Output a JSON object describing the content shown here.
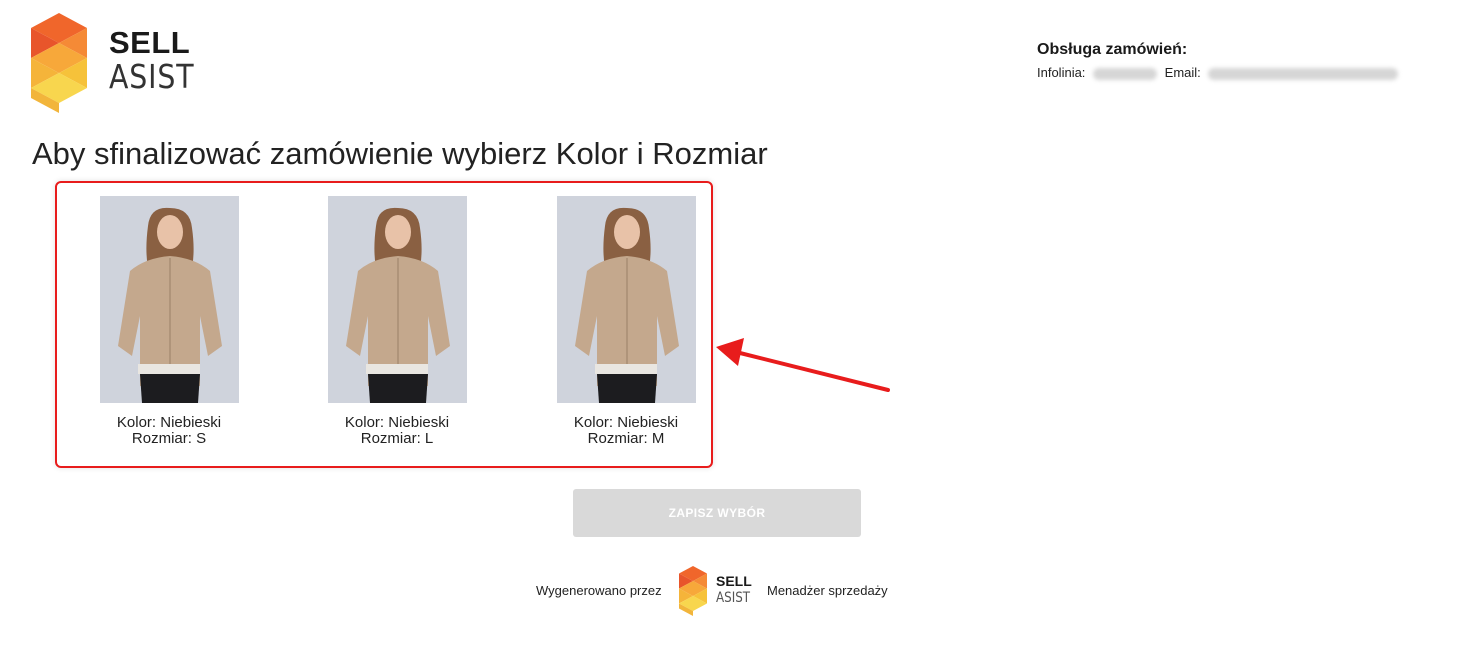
{
  "brand": {
    "line1": "SELL",
    "line2": "ASIST",
    "colors": {
      "orange": "#f26b2a",
      "dark_orange": "#e8552b",
      "yellow": "#f6c23a",
      "light_yellow": "#f8d64e"
    }
  },
  "contact": {
    "title": "Obsługa zamówień:",
    "phone_label": "Infolinia:",
    "email_label": "Email:"
  },
  "heading": "Aby sfinalizować zamówienie wybierz Kolor i Rozmiar",
  "variants": [
    {
      "color_line": "Kolor: Niebieski",
      "size_line": "Rozmiar: S"
    },
    {
      "color_line": "Kolor: Niebieski",
      "size_line": "Rozmiar: L"
    },
    {
      "color_line": "Kolor: Niebieski",
      "size_line": "Rozmiar: M"
    }
  ],
  "highlight_color": "#e81c1c",
  "save_button": {
    "label": "ZAPISZ WYBÓR",
    "color": "#d9d9d9"
  },
  "footer": {
    "prefix": "Wygenerowano przez",
    "logo_line1": "SELL",
    "logo_line2": "ASIST",
    "suffix": "Menadżer sprzedaży"
  }
}
